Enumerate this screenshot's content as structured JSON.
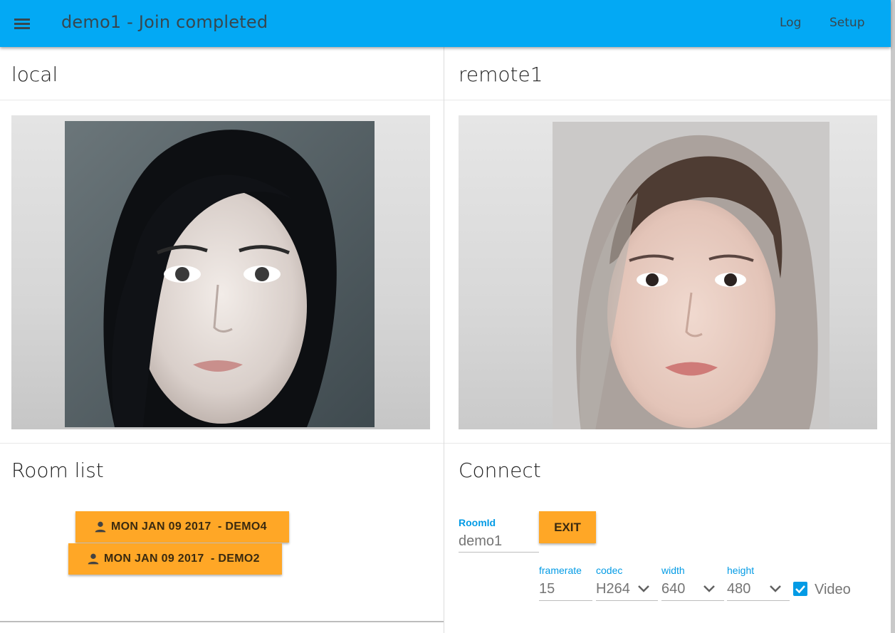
{
  "appbar": {
    "title": "demo1 - Join completed",
    "menu_icon": "menu-icon",
    "nav": {
      "log": "Log",
      "setup": "Setup"
    },
    "color": "#03a9f4"
  },
  "local": {
    "title": "local"
  },
  "remote": {
    "title": "remote1"
  },
  "room_list": {
    "title": "Room list",
    "rooms": [
      {
        "label": "MON JAN 09 2017  - DEMO4",
        "icon": "person-icon"
      },
      {
        "label": "MON JAN 09 2017  - DEMO2",
        "icon": "person-icon"
      }
    ]
  },
  "connect": {
    "title": "Connect",
    "room_id": {
      "label": "RoomId",
      "value": "demo1"
    },
    "exit_label": "EXIT",
    "framerate": {
      "label": "framerate",
      "value": "15"
    },
    "codec": {
      "label": "codec",
      "value": "H264"
    },
    "width": {
      "label": "width",
      "value": "640"
    },
    "height": {
      "label": "height",
      "value": "480"
    },
    "video": {
      "label": "Video",
      "checked": true
    },
    "accent": "#039be5",
    "button_color": "#ffa726"
  }
}
